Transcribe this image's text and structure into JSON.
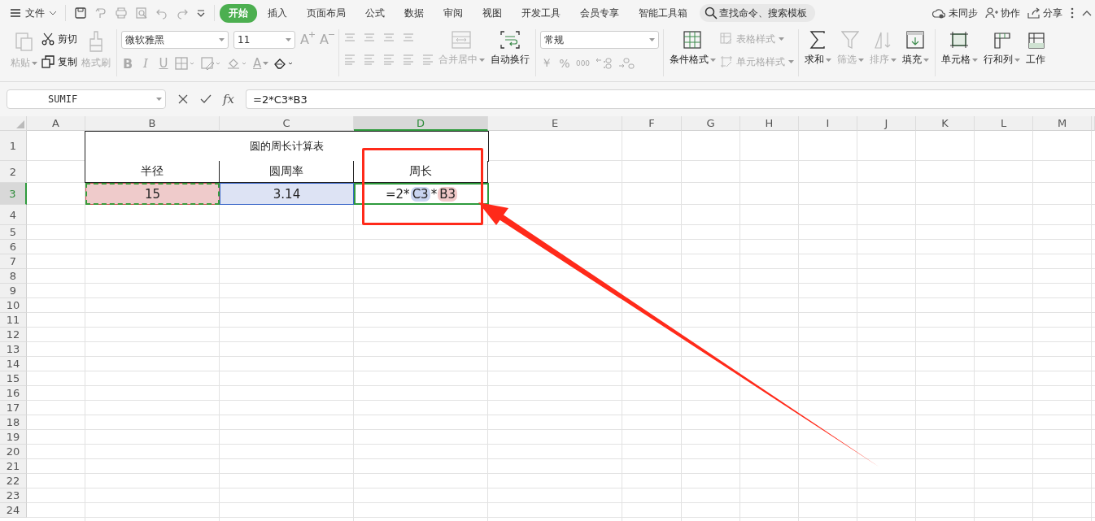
{
  "menu": {
    "file": "文件",
    "tabs": [
      {
        "label": "开始",
        "selected": true
      },
      {
        "label": "插入",
        "selected": false
      },
      {
        "label": "页面布局",
        "selected": false
      },
      {
        "label": "公式",
        "selected": false
      },
      {
        "label": "数据",
        "selected": false
      },
      {
        "label": "审阅",
        "selected": false
      },
      {
        "label": "视图",
        "selected": false
      },
      {
        "label": "开发工具",
        "selected": false
      },
      {
        "label": "会员专享",
        "selected": false
      },
      {
        "label": "智能工具箱",
        "selected": false
      }
    ],
    "search": {
      "placeholder": "查找命令、搜索模板"
    },
    "sync": "未同步",
    "collab": "协作",
    "share": "分享"
  },
  "ribbon": {
    "paste": {
      "label": "粘贴",
      "disabled": true
    },
    "cut": {
      "label": "剪切",
      "disabled": false
    },
    "copy": {
      "label": "复制",
      "disabled": false
    },
    "format_painter": {
      "label": "格式刷",
      "disabled": true
    },
    "font": {
      "value": "微软雅黑"
    },
    "font_size": {
      "value": "11"
    },
    "grow_font": "A",
    "shrink_font": "A",
    "font_styles": [
      {
        "label": "B",
        "disabled": true
      },
      {
        "label": "I",
        "disabled": true
      },
      {
        "label": "U",
        "disabled": true
      }
    ],
    "font_color": "A",
    "merge_center": {
      "label": "合并居中",
      "disabled": true
    },
    "wrap_text": {
      "label": "自动换行",
      "disabled": false
    },
    "number_format": {
      "value": "常规"
    },
    "currency": "￥",
    "percent": "%",
    "thousands": "000",
    "conditional_format": {
      "label": "条件格式",
      "disabled": false
    },
    "table_style": {
      "label": "表格样式",
      "disabled": true
    },
    "cell_style": {
      "label": "单元格样式",
      "disabled": true
    },
    "sum": {
      "label": "求和",
      "disabled": false
    },
    "filter": {
      "label": "筛选",
      "disabled": true
    },
    "sort": {
      "label": "排序",
      "disabled": true
    },
    "fill": {
      "label": "填充",
      "disabled": false
    },
    "cells": {
      "label": "单元格",
      "disabled": false
    },
    "rows_cols": {
      "label": "行和列",
      "disabled": false
    },
    "worksheet": {
      "label": "工作",
      "disabled": false
    }
  },
  "formula_bar": {
    "name_box": "SUMIF",
    "fx": "fx",
    "formula": "=2*C3*B3"
  },
  "sheet": {
    "columns": [
      {
        "label": "A",
        "selected": false
      },
      {
        "label": "B",
        "selected": false
      },
      {
        "label": "C",
        "selected": false
      },
      {
        "label": "D",
        "selected": true
      },
      {
        "label": "E",
        "selected": false
      },
      {
        "label": "F",
        "selected": false
      },
      {
        "label": "G",
        "selected": false
      },
      {
        "label": "H",
        "selected": false
      },
      {
        "label": "I",
        "selected": false
      },
      {
        "label": "J",
        "selected": false
      },
      {
        "label": "K",
        "selected": false
      },
      {
        "label": "L",
        "selected": false
      },
      {
        "label": "M",
        "selected": false
      }
    ],
    "rows": [
      {
        "label": "1",
        "selected": false
      },
      {
        "label": "2",
        "selected": false
      },
      {
        "label": "3",
        "selected": true
      },
      {
        "label": "4",
        "selected": false
      },
      {
        "label": "5",
        "selected": false
      },
      {
        "label": "6",
        "selected": false
      },
      {
        "label": "7",
        "selected": false
      },
      {
        "label": "8",
        "selected": false
      },
      {
        "label": "9",
        "selected": false
      },
      {
        "label": "10",
        "selected": false
      },
      {
        "label": "11",
        "selected": false
      },
      {
        "label": "12",
        "selected": false
      },
      {
        "label": "13",
        "selected": false
      },
      {
        "label": "14",
        "selected": false
      },
      {
        "label": "15",
        "selected": false
      },
      {
        "label": "16",
        "selected": false
      },
      {
        "label": "17",
        "selected": false
      },
      {
        "label": "18",
        "selected": false
      },
      {
        "label": "19",
        "selected": false
      },
      {
        "label": "20",
        "selected": false
      },
      {
        "label": "21",
        "selected": false
      },
      {
        "label": "22",
        "selected": false
      },
      {
        "label": "23",
        "selected": false
      },
      {
        "label": "24",
        "selected": false
      }
    ],
    "title": "圆的周长计算表",
    "headers": [
      "半径",
      "圆周率",
      "周长"
    ],
    "b3": {
      "text": "15",
      "color": "#efcbcb"
    },
    "c3": {
      "text": "3.14",
      "color": "#dde3f4"
    },
    "d3": [
      {
        "text": "=2*"
      },
      {
        "text": "C3",
        "color": "#c9d4f0"
      },
      {
        "text": "*"
      },
      {
        "text": "B3",
        "color": "#f1c9c9"
      }
    ]
  }
}
